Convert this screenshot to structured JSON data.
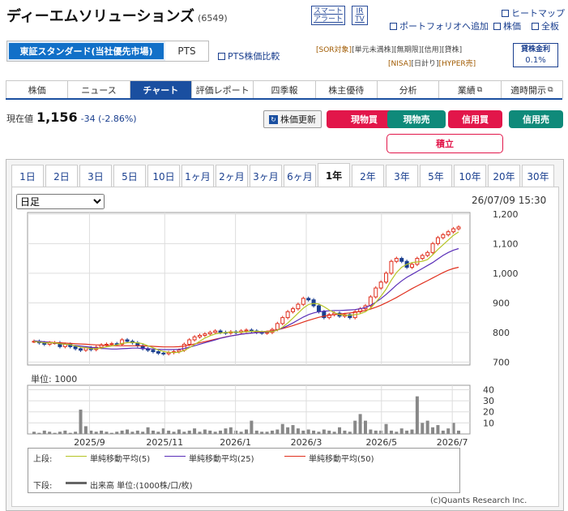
{
  "header": {
    "company": "ディーエムソリューションズ",
    "code": "(6549)",
    "alert_line1": "スマート",
    "alert_line2": "アラート",
    "ir_line1": "IR",
    "ir_line2": "TV",
    "heatmap": "ヒートマップ",
    "portfolio": "ポートフォリオへ追加",
    "kabuka": "株価",
    "zenban": "全板"
  },
  "market": {
    "selected": "東証スタンダード(当社優先市場)",
    "pts": "PTS",
    "pts_compare": "PTS株価比較"
  },
  "tags": {
    "row1": [
      "[SOR対象]",
      "[単元未満株]",
      "[無期限]",
      "[信用]",
      "[貸株]"
    ],
    "row2": [
      "[NISA]",
      "[日計り]",
      "[HYPER売]"
    ],
    "loan_label": "貸株金利",
    "loan_rate": "0.1%"
  },
  "tabs": [
    "株価",
    "ニュース",
    "チャート",
    "評価レポート",
    "四季報",
    "株主優待",
    "分析",
    "業績",
    "適時開示"
  ],
  "quote": {
    "label": "現在値",
    "price": "1,156",
    "change": "-34 (-2.86%)",
    "refresh": "株価更新"
  },
  "actions": {
    "spot_buy": "現物買",
    "spot_sell": "現物売",
    "margin_buy": "信用買",
    "margin_sell": "信用売",
    "tsumitate": "積立",
    "colors": {
      "red": "#e2164a",
      "teal": "#0f8a7a"
    }
  },
  "periods": [
    "1日",
    "2日",
    "3日",
    "5日",
    "10日",
    "1ヶ月",
    "2ヶ月",
    "3ヶ月",
    "6ヶ月",
    "1年",
    "2年",
    "3年",
    "5年",
    "10年",
    "20年",
    "30年"
  ],
  "chart_controls": {
    "interval": "日足",
    "timestamp": "26/07/09 15:30",
    "volume_unit": "単位: 1000"
  },
  "legend": {
    "upper": "上段:",
    "ma5": "単純移動平均(5)",
    "ma25": "単純移動平均(25)",
    "ma50": "単純移動平均(50)",
    "lower": "下段:",
    "volume": "出来高 単位:(1000株/口/枚)",
    "copyright": "(c)Quants Research Inc.",
    "colors": {
      "ma5": "#b5c424",
      "ma25": "#5a2fb8",
      "ma50": "#e0301e",
      "up": "#e0301e",
      "down": "#1a3f8f",
      "vol": "#888888"
    }
  },
  "chart_data": {
    "type": "line",
    "title": "",
    "price_axis": {
      "ticks": [
        "1,200",
        "1,100",
        "1,000",
        "900",
        "800",
        "700"
      ],
      "ylim": [
        690,
        1205
      ]
    },
    "volume_axis": {
      "ticks": [
        "40",
        "30",
        "20",
        "10"
      ],
      "ylim": [
        0,
        44
      ]
    },
    "x_ticks": [
      "2025/9",
      "2025/11",
      "2026/1",
      "2026/3",
      "2026/5",
      "2026/7"
    ],
    "months": [
      "2025/7",
      "2025/8",
      "2025/9",
      "2025/10",
      "2025/11",
      "2025/12",
      "2026/1",
      "2026/2",
      "2026/3",
      "2026/4",
      "2026/5",
      "2026/6",
      "2026/7"
    ],
    "close": [
      770,
      765,
      760,
      765,
      765,
      752,
      760,
      752,
      745,
      740,
      748,
      742,
      750,
      758,
      760,
      762,
      760,
      775,
      770,
      765,
      755,
      745,
      740,
      735,
      730,
      728,
      732,
      735,
      740,
      760,
      775,
      785,
      790,
      795,
      800,
      805,
      800,
      798,
      802,
      800,
      805,
      808,
      805,
      800,
      798,
      800,
      810,
      830,
      850,
      870,
      880,
      895,
      915,
      910,
      890,
      870,
      850,
      860,
      865,
      855,
      860,
      850,
      870,
      880,
      890,
      920,
      950,
      970,
      1000,
      1040,
      1050,
      1040,
      1020,
      1030,
      1050,
      1060,
      1070,
      1100,
      1120,
      1130,
      1140,
      1150,
      1156
    ],
    "ma25": [
      772,
      770,
      768,
      766,
      764,
      762,
      760,
      758,
      756,
      754,
      752,
      750,
      748,
      746,
      745,
      744,
      744,
      745,
      746,
      747,
      747,
      746,
      745,
      744,
      743,
      742,
      742,
      742,
      743,
      746,
      750,
      755,
      760,
      765,
      770,
      775,
      780,
      784,
      788,
      791,
      794,
      796,
      798,
      799,
      800,
      801,
      803,
      808,
      815,
      823,
      832,
      842,
      852,
      860,
      866,
      870,
      872,
      873,
      874,
      874,
      875,
      876,
      877,
      880,
      884,
      892,
      902,
      914,
      928,
      944,
      960,
      974,
      986,
      996,
      1006,
      1016,
      1026,
      1036,
      1048,
      1060,
      1070,
      1078,
      1083
    ],
    "ma50": [
      770,
      769,
      768,
      767,
      766,
      765,
      764,
      763,
      762,
      761,
      760,
      759,
      758,
      757,
      756,
      755,
      755,
      755,
      755,
      755,
      755,
      755,
      754,
      753,
      752,
      751,
      751,
      751,
      752,
      754,
      757,
      761,
      765,
      769,
      773,
      777,
      781,
      785,
      788,
      791,
      794,
      796,
      798,
      800,
      802,
      804,
      806,
      809,
      813,
      818,
      823,
      829,
      835,
      841,
      846,
      851,
      855,
      858,
      860,
      862,
      864,
      866,
      868,
      871,
      874,
      879,
      885,
      892,
      900,
      909,
      918,
      928,
      938,
      948,
      957,
      966,
      975,
      984,
      993,
      1002,
      1010,
      1016,
      1020
    ],
    "volume": [
      2,
      1,
      3,
      2,
      1,
      2,
      3,
      1,
      2,
      22,
      7,
      3,
      2,
      3,
      2,
      1,
      2,
      3,
      4,
      2,
      3,
      2,
      6,
      3,
      2,
      5,
      3,
      2,
      4,
      2,
      3,
      5,
      2,
      4,
      3,
      2,
      3,
      5,
      6,
      3,
      2,
      4,
      12,
      3,
      2,
      2,
      3,
      4,
      9,
      6,
      8,
      5,
      3,
      4,
      3,
      2,
      4,
      3,
      2,
      6,
      3,
      2,
      12,
      18,
      12,
      4,
      3,
      3,
      9,
      3,
      2,
      5,
      3,
      4,
      34,
      10,
      12,
      6,
      8,
      3,
      5,
      10,
      3
    ],
    "series": [
      {
        "name": "単純移動平均(5)"
      },
      {
        "name": "単純移動平均(25)"
      },
      {
        "name": "単純移動平均(50)"
      },
      {
        "name": "出来高 単位:(1000株/口/枚)"
      }
    ]
  }
}
